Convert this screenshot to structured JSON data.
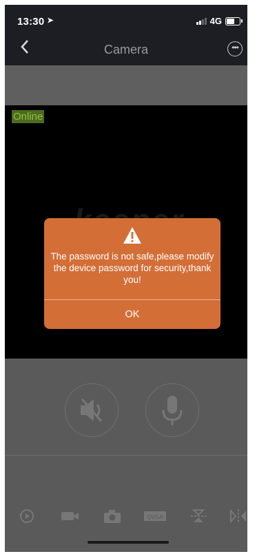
{
  "status_bar": {
    "time": "13:30",
    "network": "4G"
  },
  "header": {
    "title": "Camera"
  },
  "video": {
    "status_label": "Online",
    "watermark": "keeper"
  },
  "dialog": {
    "message": "The password is not safe,please modify the device password for security,thank you!",
    "ok_label": "OK"
  },
  "toolbar": {
    "quality_label": "QVGA"
  },
  "colors": {
    "dialog_bg": "#d36e37",
    "online_bg": "#4d6b20",
    "online_text": "#8fbf3a"
  }
}
